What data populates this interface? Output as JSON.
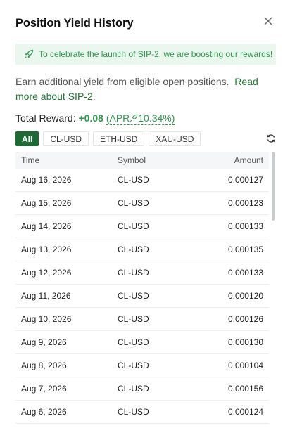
{
  "header": {
    "title": "Position Yield History",
    "close_icon": "close-icon"
  },
  "banner": {
    "icon": "rocket-icon",
    "text": "To celebrate the launch of SIP-2, we are boosting our rewards!"
  },
  "description": {
    "text": "Earn additional yield from eligible open positions.",
    "link": "Read more about SIP-2",
    "suffix": "."
  },
  "reward": {
    "label": "Total Reward:",
    "amount": "+0.08",
    "apr_prefix": "(APR",
    "apr_icon": "rocket-icon",
    "apr_value": "10.34%)"
  },
  "filters": [
    {
      "label": "All",
      "active": true
    },
    {
      "label": "CL-USD",
      "active": false
    },
    {
      "label": "ETH-USD",
      "active": false
    },
    {
      "label": "XAU-USD",
      "active": false
    }
  ],
  "refresh_icon": "refresh-icon",
  "table": {
    "columns": [
      "Time",
      "Symbol",
      "Amount"
    ],
    "rows": [
      [
        "Aug 16, 2026",
        "CL-USD",
        "0.000127"
      ],
      [
        "Aug 15, 2026",
        "CL-USD",
        "0.000123"
      ],
      [
        "Aug 14, 2026",
        "CL-USD",
        "0.000133"
      ],
      [
        "Aug 13, 2026",
        "CL-USD",
        "0.000135"
      ],
      [
        "Aug 12, 2026",
        "CL-USD",
        "0.000133"
      ],
      [
        "Aug 11, 2026",
        "CL-USD",
        "0.000120"
      ],
      [
        "Aug 10, 2026",
        "CL-USD",
        "0.000126"
      ],
      [
        "Aug 9, 2026",
        "CL-USD",
        "0.000130"
      ],
      [
        "Aug 8, 2026",
        "CL-USD",
        "0.000104"
      ],
      [
        "Aug 7, 2026",
        "CL-USD",
        "0.000156"
      ],
      [
        "Aug 6, 2026",
        "CL-USD",
        "0.000124"
      ]
    ]
  },
  "colors": {
    "accent": "#2e9a4a",
    "active_chip": "#1a6b34",
    "banner_bg": "#eaf7ee"
  }
}
